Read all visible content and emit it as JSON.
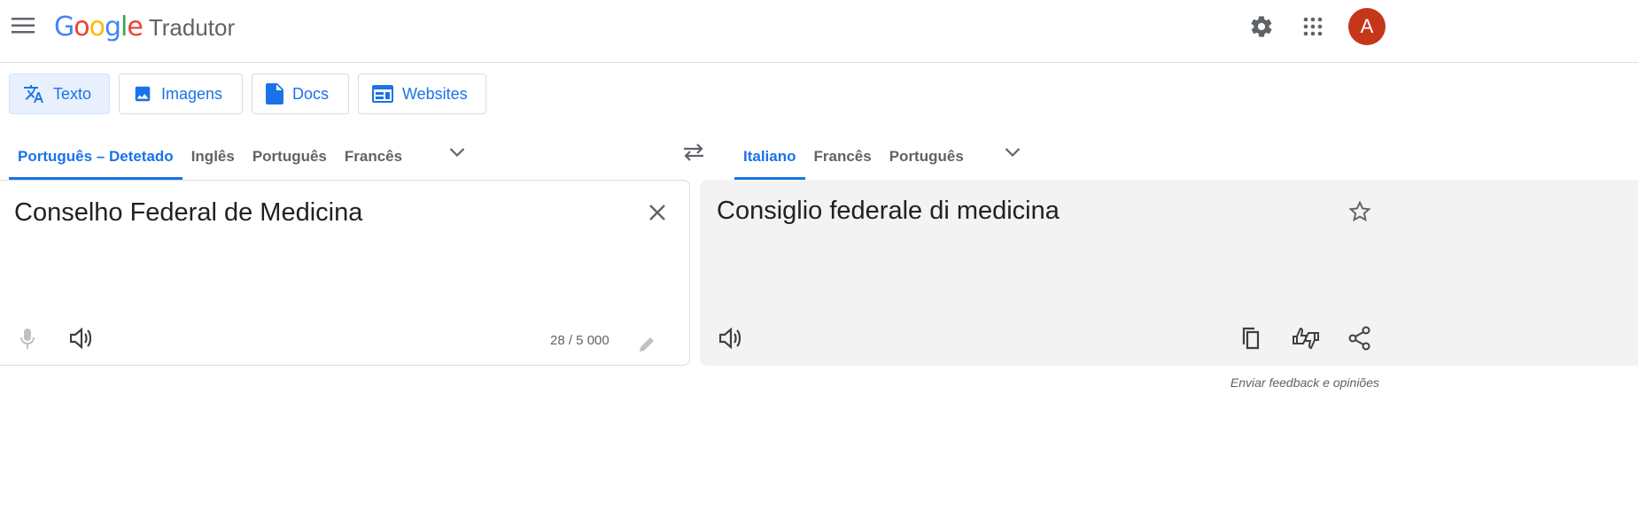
{
  "header": {
    "logo_brand": "Google",
    "logo_app": "Tradutor",
    "avatar_letter": "A",
    "icons": {
      "menu": "hamburger-menu-icon",
      "settings": "gear-icon",
      "apps": "apps-grid-icon"
    }
  },
  "modes": [
    {
      "label": "Texto",
      "icon": "translate-icon",
      "active": true
    },
    {
      "label": "Imagens",
      "icon": "image-icon",
      "active": false
    },
    {
      "label": "Docs",
      "icon": "document-icon",
      "active": false
    },
    {
      "label": "Websites",
      "icon": "website-icon",
      "active": false
    }
  ],
  "source_langs": [
    "Português – Detetado",
    "Inglês",
    "Português",
    "Francês"
  ],
  "target_langs": [
    "Italiano",
    "Francês",
    "Português"
  ],
  "source": {
    "text": "Conselho Federal de Medicina",
    "counter": "28 / 5 000"
  },
  "target": {
    "text": "Consiglio federale di medicina"
  },
  "feedback": "Enviar feedback e opiniões",
  "colors": {
    "accent": "#1a73e8",
    "avatar": "#c5361b",
    "target_bg": "#f3f3f3"
  }
}
